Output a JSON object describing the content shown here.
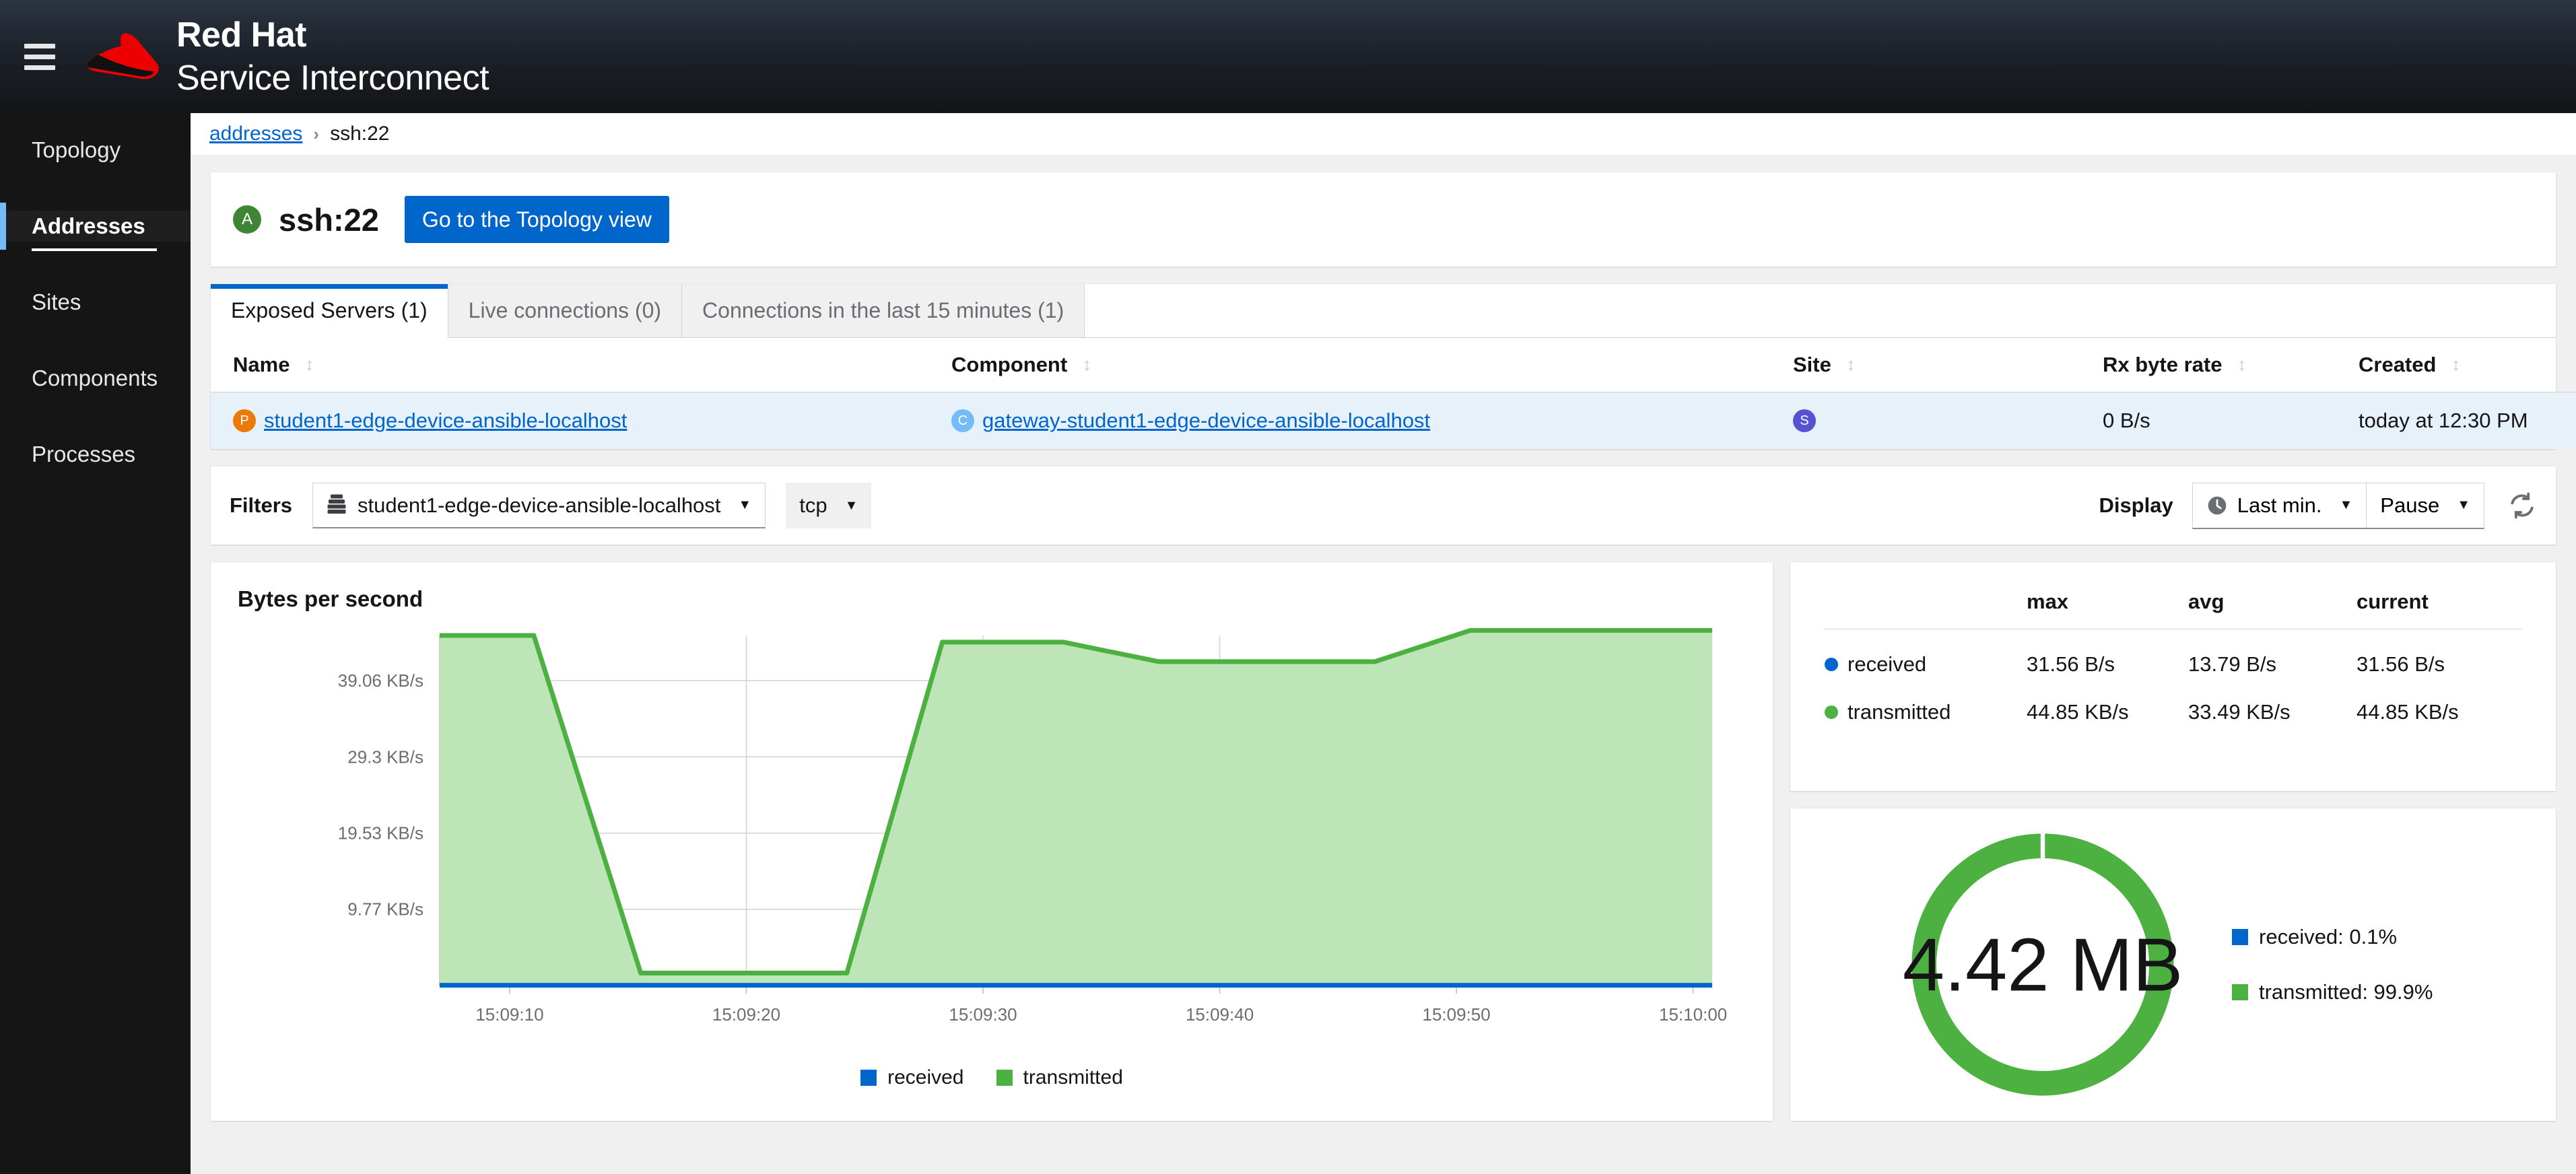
{
  "masthead": {
    "brand_top": "Red Hat",
    "brand_bottom": "Service Interconnect"
  },
  "sidebar": {
    "items": [
      {
        "label": "Topology",
        "active": false
      },
      {
        "label": "Addresses",
        "active": true
      },
      {
        "label": "Sites",
        "active": false
      },
      {
        "label": "Components",
        "active": false
      },
      {
        "label": "Processes",
        "active": false
      }
    ]
  },
  "breadcrumb": {
    "parent": "addresses",
    "separator": "›",
    "current": "ssh:22"
  },
  "header": {
    "badge": "A",
    "title": "ssh:22",
    "topology_button": "Go to the Topology view"
  },
  "tabs": [
    {
      "label": "Exposed Servers (1)",
      "active": true
    },
    {
      "label": "Live connections (0)",
      "active": false
    },
    {
      "label": "Connections in the last 15 minutes (1)",
      "active": false
    }
  ],
  "table": {
    "columns": [
      "Name",
      "Component",
      "Site",
      "Rx byte rate",
      "Created"
    ],
    "rows": [
      {
        "name_badge": "P",
        "name": "student1-edge-device-ansible-localhost",
        "component_badge": "C",
        "component": "gateway-student1-edge-device-ansible-localhost",
        "site_badge": "S",
        "site": "",
        "rx_byte_rate": "0 B/s",
        "created": "today at 12:30 PM"
      }
    ]
  },
  "filters": {
    "label": "Filters",
    "process_select": "student1-edge-device-ansible-localhost",
    "protocol_select": "tcp",
    "display_label": "Display",
    "time_select": "Last min.",
    "update_select": "Pause",
    "refresh_icon": "refresh-icon"
  },
  "chart_data": {
    "type": "area",
    "title": "Bytes per second",
    "xlabel": "",
    "ylabel": "",
    "x": [
      "15:09:10",
      "15:09:20",
      "15:09:30",
      "15:09:40",
      "15:09:50",
      "15:10:00"
    ],
    "xtick_labels": [
      "15:09:10",
      "15:09:20",
      "15:09:30",
      "15:09:40",
      "15:09:50",
      "15:10:00"
    ],
    "ytick_labels": [
      "9.77 KB/s",
      "19.53 KB/s",
      "29.3 KB/s",
      "39.06 KB/s"
    ],
    "ytick_values": [
      9.77,
      19.53,
      29.3,
      39.06
    ],
    "ylim": [
      0,
      44.85
    ],
    "y_unit": "KB/s",
    "grid": true,
    "legend_position": "bottom",
    "series": [
      {
        "name": "received",
        "color": "#06c",
        "values": [
          0.031,
          0.031,
          0.031,
          0.031,
          0.031,
          0.031,
          0.031,
          0.031,
          0.031,
          0.031,
          0.031,
          0.031
        ]
      },
      {
        "name": "transmitted",
        "color": "#4cb140",
        "fill": "#bde5b8",
        "values": [
          44.85,
          44.85,
          1.6,
          1.6,
          1.6,
          44.0,
          44.0,
          41.5,
          41.5,
          41.5,
          45.5,
          45.5
        ]
      }
    ],
    "series_x_fraction": [
      0.0,
      0.074,
      0.158,
      0.23,
      0.32,
      0.395,
      0.49,
      0.565,
      0.64,
      0.735,
      0.81,
      1.0
    ]
  },
  "stats": {
    "columns": [
      "",
      "max",
      "avg",
      "current"
    ],
    "rows": [
      {
        "name": "received",
        "color": "#06c",
        "max": "31.56 B/s",
        "avg": "13.79 B/s",
        "current": "31.56 B/s"
      },
      {
        "name": "transmitted",
        "color": "#4cb140",
        "max": "44.85 KB/s",
        "avg": "33.49 KB/s",
        "current": "44.85 KB/s"
      }
    ]
  },
  "donut": {
    "type": "pie",
    "center_label": "4.42 MB",
    "slices": [
      {
        "name": "received",
        "label": "received: 0.1%",
        "value": 0.1,
        "color": "#06c"
      },
      {
        "name": "transmitted",
        "label": "transmitted: 99.9%",
        "value": 99.9,
        "color": "#4cb140"
      }
    ]
  },
  "chart_legend": [
    {
      "label": "received",
      "color": "#06c"
    },
    {
      "label": "transmitted",
      "color": "#4cb140"
    }
  ]
}
